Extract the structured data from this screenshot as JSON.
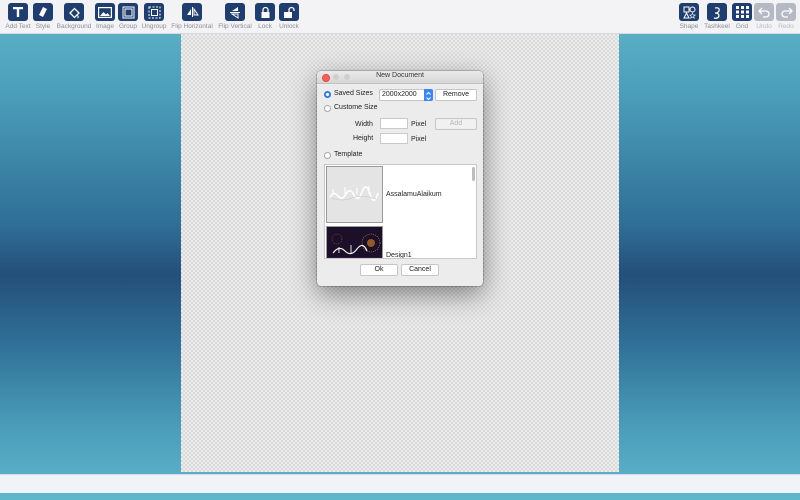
{
  "toolbar": {
    "items": [
      {
        "label": "Add Text",
        "icon": "text-icon"
      },
      {
        "label": "Style",
        "icon": "style-icon"
      },
      {
        "label": "Background",
        "icon": "background-icon"
      },
      {
        "label": "Image",
        "icon": "image-icon"
      },
      {
        "label": "Group",
        "icon": "group-icon"
      },
      {
        "label": "Ungroup",
        "icon": "ungroup-icon"
      },
      {
        "label": "Flip Horizontal",
        "icon": "flip-horizontal-icon"
      },
      {
        "label": "Flip Vertical",
        "icon": "flip-vertical-icon"
      },
      {
        "label": "Lock",
        "icon": "lock-icon"
      },
      {
        "label": "Unlock",
        "icon": "unlock-icon"
      }
    ],
    "right_items": [
      {
        "label": "Shape",
        "icon": "shape-icon"
      },
      {
        "label": "Tashkeel",
        "icon": "tashkeel-icon"
      },
      {
        "label": "Grid",
        "icon": "grid-icon"
      },
      {
        "label": "Undo",
        "icon": "undo-icon",
        "disabled": true
      },
      {
        "label": "Redo",
        "icon": "redo-icon",
        "disabled": true
      }
    ]
  },
  "dialog": {
    "title": "New Document",
    "saved_sizes_label": "Saved Sizes",
    "saved_size_value": "2000x2000",
    "remove_label": "Remove",
    "custom_size_label": "Custome Size",
    "width_label": "Width",
    "height_label": "Height",
    "width_unit": "Pixel",
    "height_unit": "Pixel",
    "add_label": "Add",
    "template_label": "Template",
    "templates": [
      {
        "name": "AssalamuAlaikum"
      },
      {
        "name": "Design1"
      }
    ],
    "ok_label": "Ok",
    "cancel_label": "Cancel"
  },
  "colors": {
    "toolbar_icon": "#1f3e6e",
    "radio_selected": "#3b88f1",
    "close_button": "#fc605c",
    "minimize_button": "#fdbc40",
    "zoom_button": "#34c84a"
  }
}
